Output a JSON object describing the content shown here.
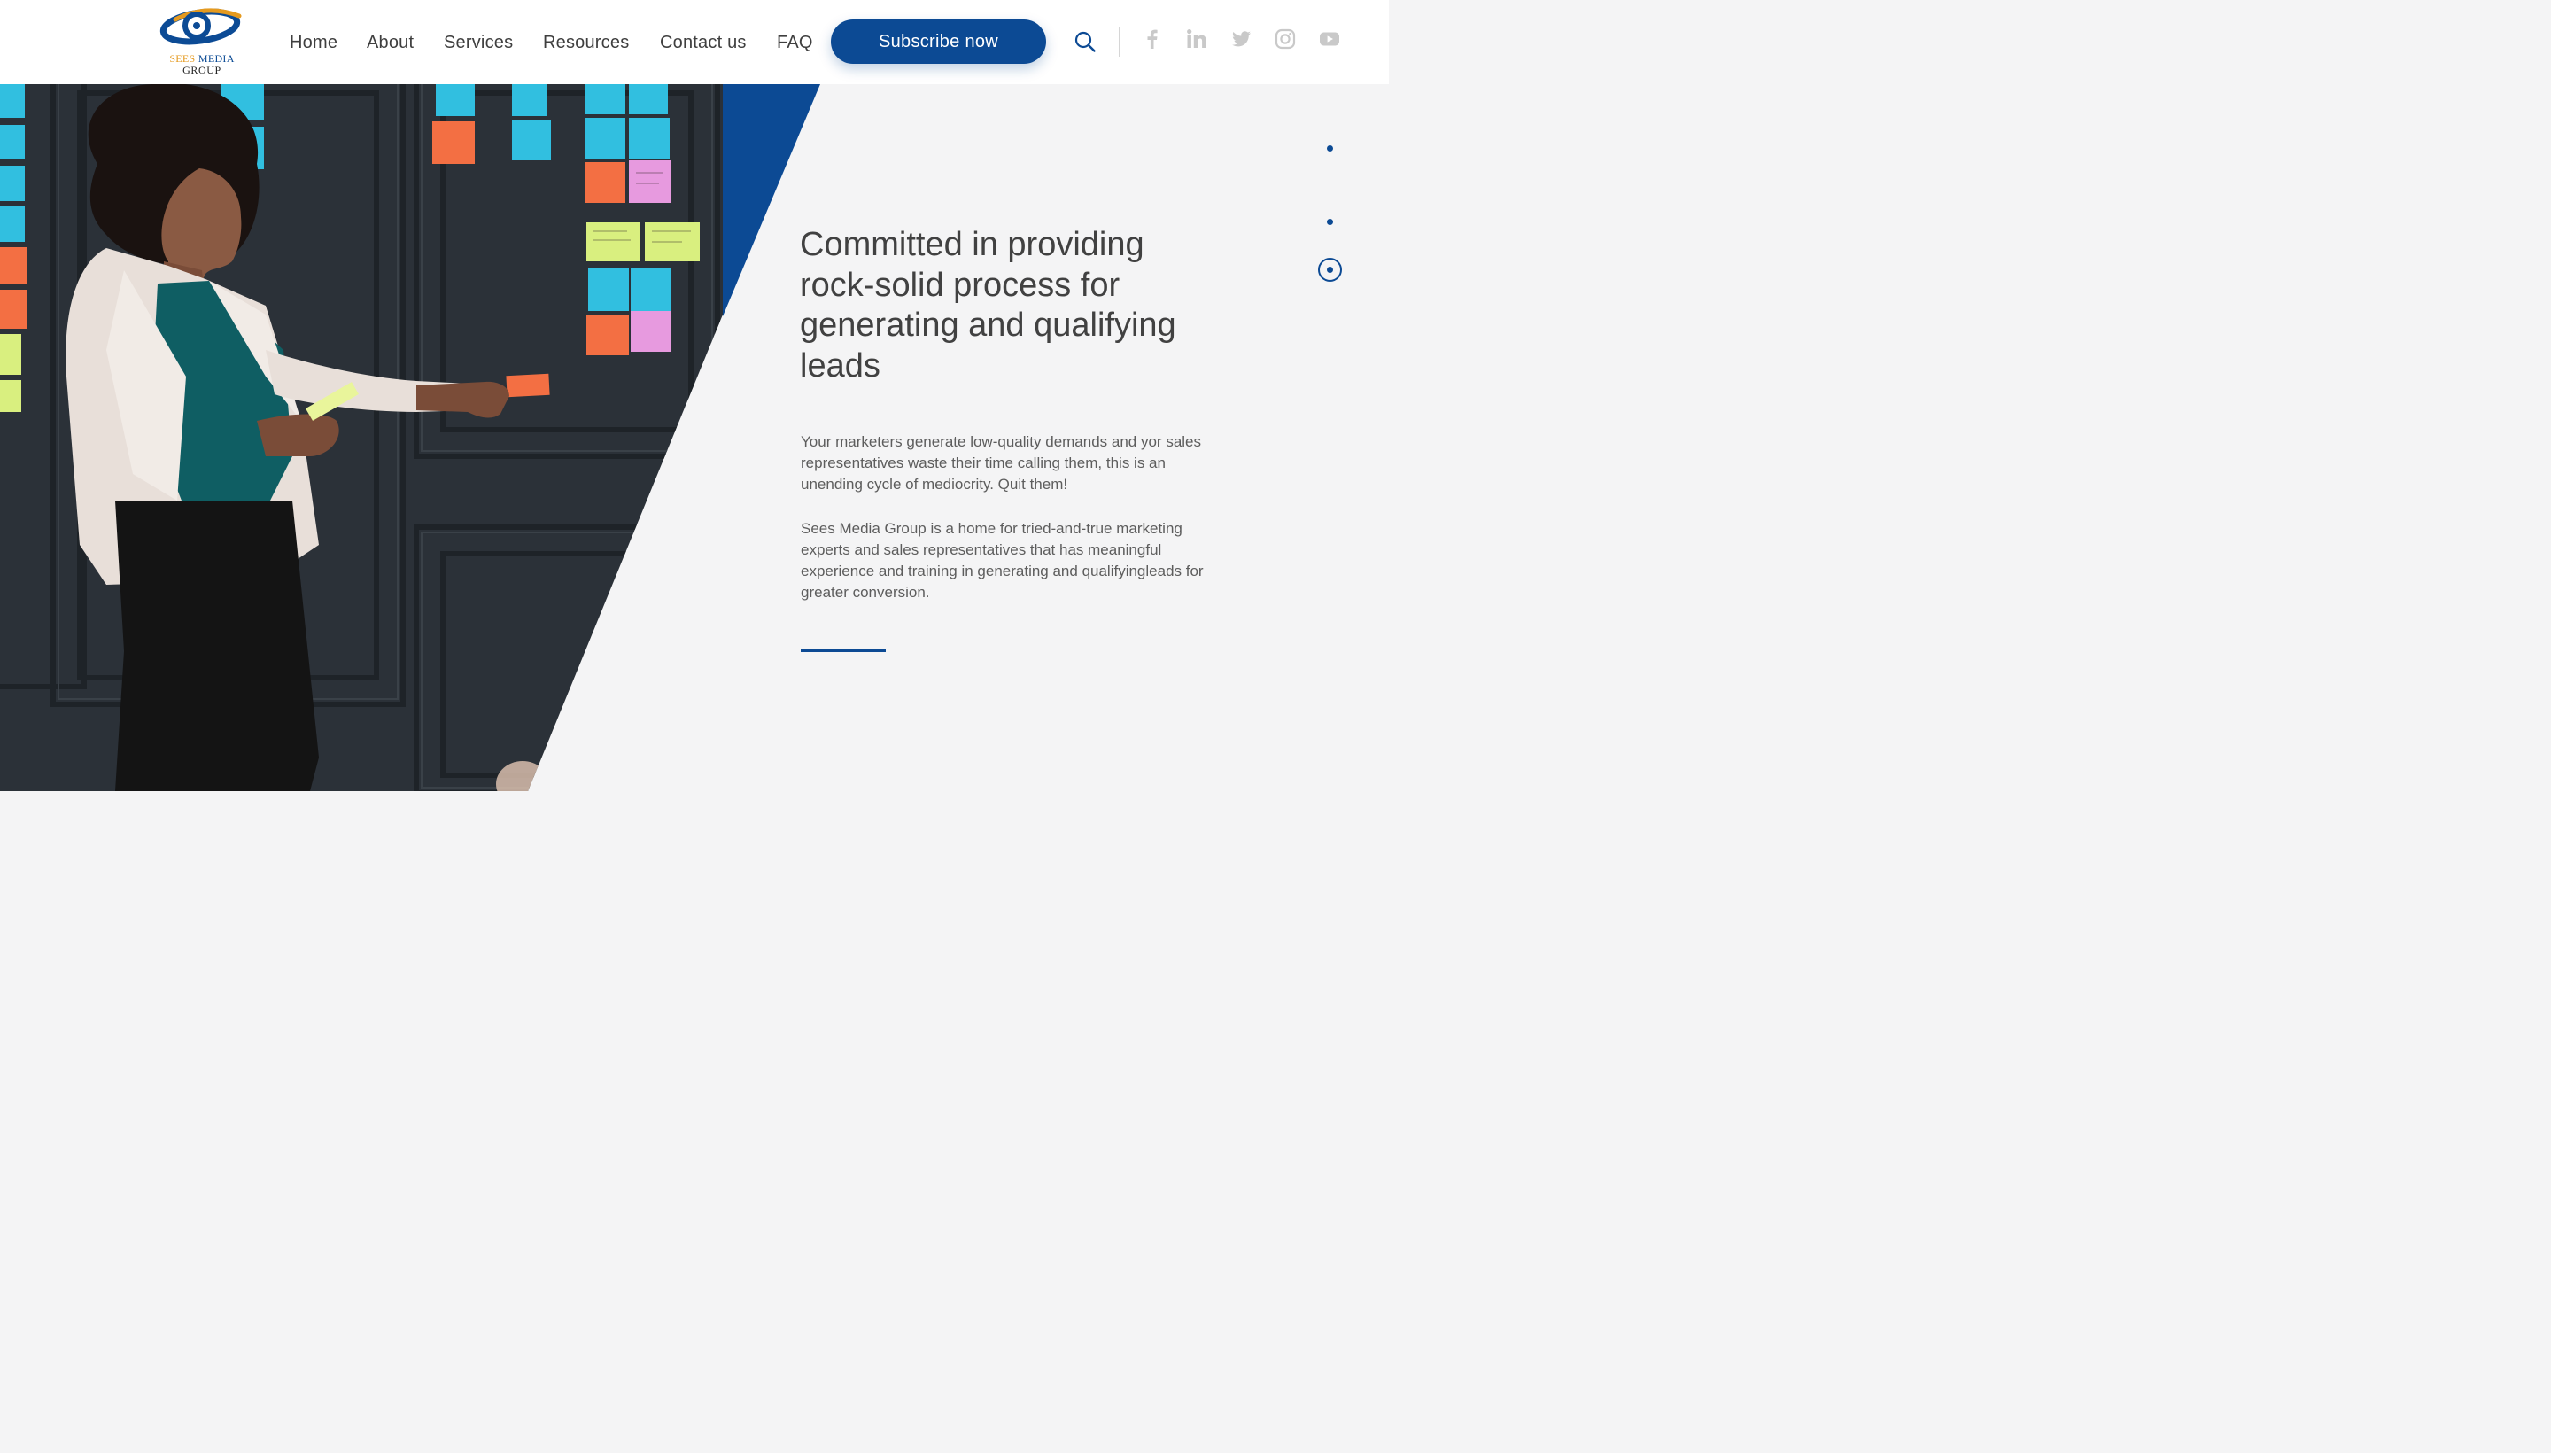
{
  "brand": {
    "name_part1": "SEES",
    "name_part2": "MEDIA",
    "name_line2": "GROUP",
    "colors": {
      "blue": "#0c4a94",
      "orange": "#e59a1f"
    }
  },
  "nav": {
    "items": [
      {
        "label": "Home"
      },
      {
        "label": "About"
      },
      {
        "label": "Services"
      },
      {
        "label": "Resources"
      },
      {
        "label": "Contact us"
      },
      {
        "label": "FAQ"
      }
    ],
    "subscribe_label": "Subscribe now",
    "search_icon": "search-icon",
    "social_icons": [
      "facebook-icon",
      "linkedin-icon",
      "twitter-icon",
      "instagram-icon",
      "youtube-icon"
    ]
  },
  "hero": {
    "image": "woman-presenting-sticky-notes-photo",
    "headline": "Committed in providing rock-solid process for generating and qualifying leads",
    "paragraph1": "Your marketers generate low-quality demands and yor sales representatives waste their time calling them, this is an unending cycle of mediocrity. Quit them!",
    "paragraph2": "Sees Media Group is a home for tried-and-true marketing experts and sales representatives that has meaningful experience and training in generating and qualifyingleads for greater conversion.",
    "slides": {
      "count": 3,
      "active_index": 2
    }
  }
}
